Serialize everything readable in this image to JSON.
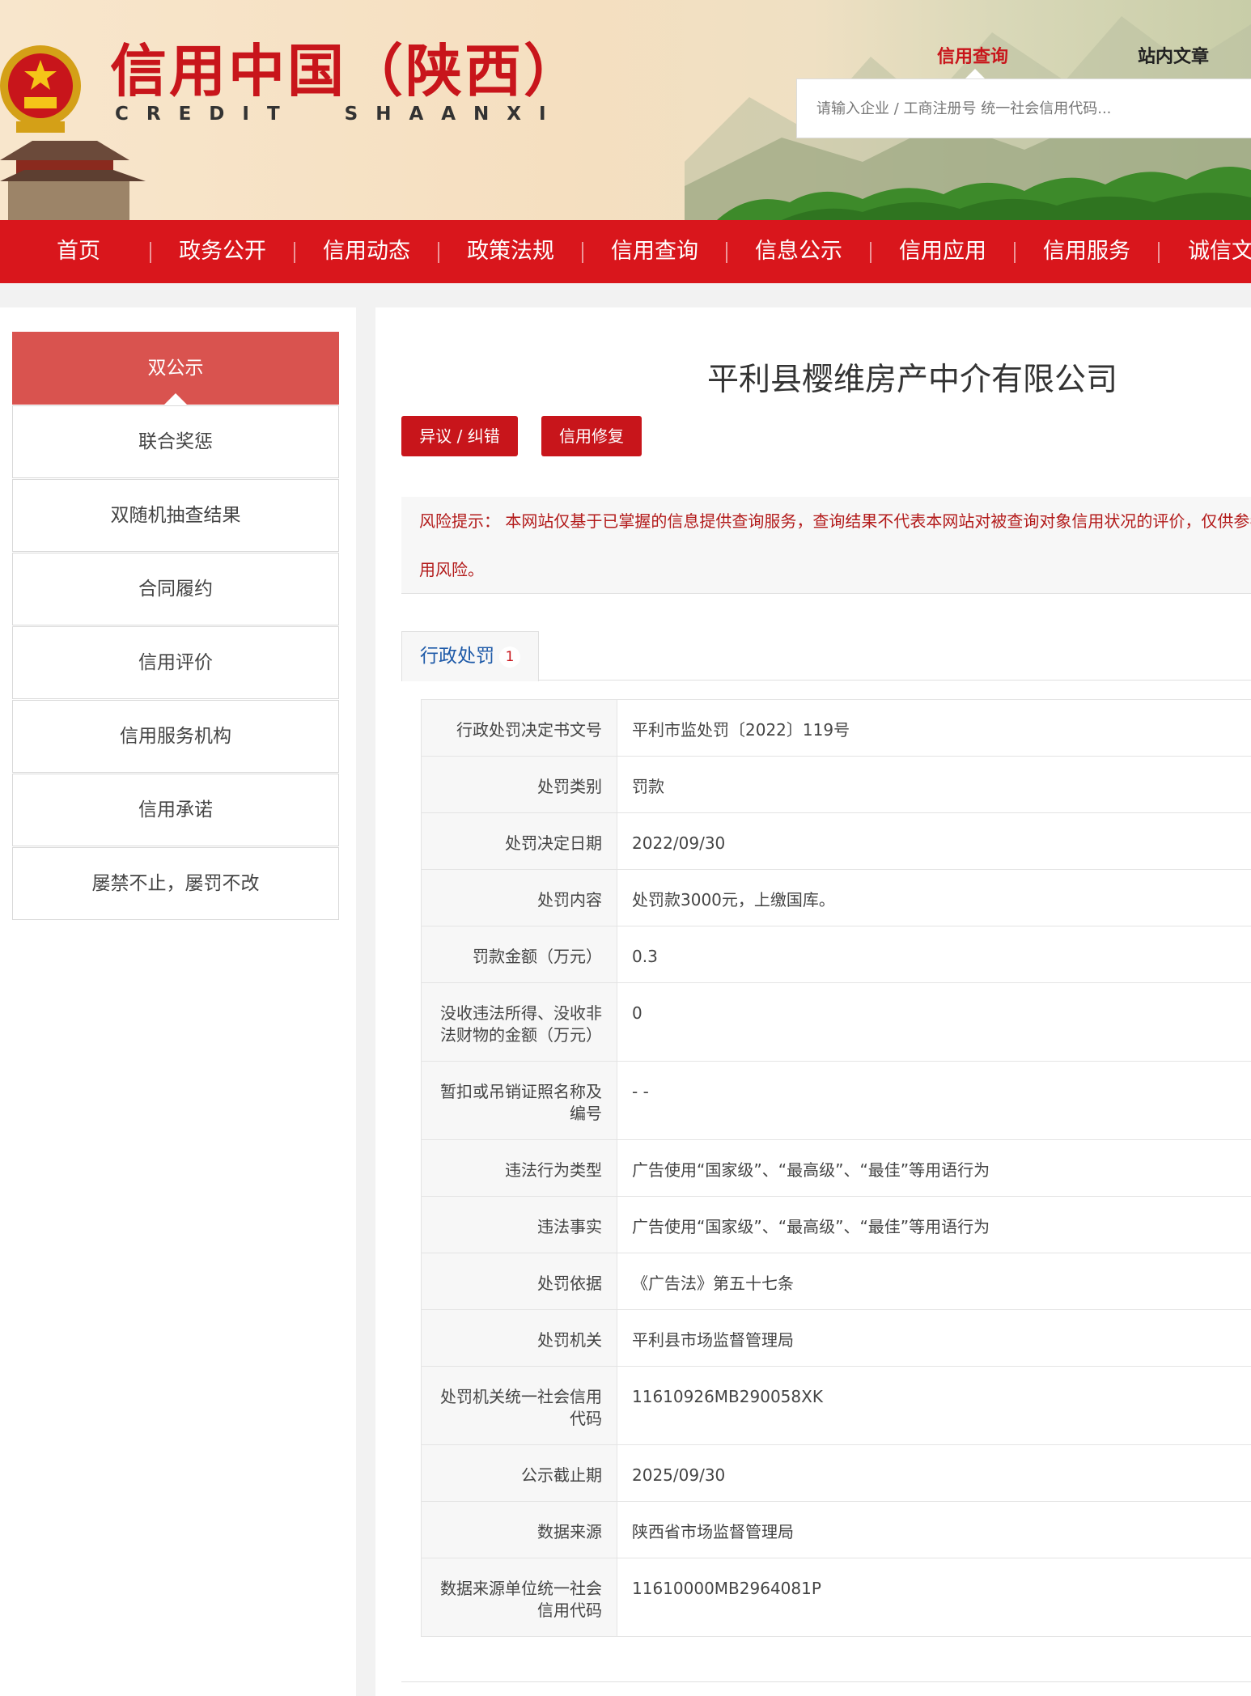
{
  "header": {
    "logo_cn": "信用中国（陕西）",
    "logo_en_1": "CREDIT",
    "logo_en_2": "SHAANXI",
    "tab_credit_query": "信用查询",
    "tab_site_article": "站内文章",
    "search_placeholder": "请输入企业 / 工商注册号 统一社会信用代码..."
  },
  "nav": {
    "items": [
      "首页",
      "政务公开",
      "信用动态",
      "政策法规",
      "信用查询",
      "信息公示",
      "信用应用",
      "信用服务",
      "诚信文"
    ]
  },
  "sidebar": {
    "items": [
      "双公示",
      "联合奖惩",
      "双随机抽查结果",
      "合同履约",
      "信用评价",
      "信用服务机构",
      "信用承诺",
      "屡禁不止，屡罚不改"
    ]
  },
  "main": {
    "company_name": "平利县樱维房产中介有限公司",
    "btn_dispute": "异议 / 纠错",
    "btn_repair": "信用修复",
    "risk_line1": "风险提示： 本网站仅基于已掌握的信息提供查询服务，查询结果不代表本网站对被查询对象信用状况的评价，仅供参考",
    "risk_line2": "用风险。",
    "tab_label": "行政处罚",
    "tab_count": "1",
    "rows": [
      {
        "k": "行政处罚决定书文号",
        "v": "平利市监处罚〔2022〕119号"
      },
      {
        "k": "处罚类别",
        "v": "罚款"
      },
      {
        "k": "处罚决定日期",
        "v": "2022/09/30"
      },
      {
        "k": "处罚内容",
        "v": "处罚款3000元，上缴国库。"
      },
      {
        "k": "罚款金额（万元）",
        "v": "0.3"
      },
      {
        "k": "没收违法所得、没收非法财物的金额（万元）",
        "v": "0"
      },
      {
        "k": "暂扣或吊销证照名称及编号",
        "v": "- -"
      },
      {
        "k": "违法行为类型",
        "v": "广告使用“国家级”、“最高级”、“最佳”等用语行为"
      },
      {
        "k": "违法事实",
        "v": "广告使用“国家级”、“最高级”、“最佳”等用语行为"
      },
      {
        "k": "处罚依据",
        "v": "《广告法》第五十七条"
      },
      {
        "k": "处罚机关",
        "v": "平利县市场监督管理局"
      },
      {
        "k": "处罚机关统一社会信用代码",
        "v": "11610926MB290058XK"
      },
      {
        "k": "公示截止期",
        "v": "2025/09/30"
      },
      {
        "k": "数据来源",
        "v": "陕西省市场监督管理局"
      },
      {
        "k": "数据来源单位统一社会信用代码",
        "v": "11610000MB2964081P"
      }
    ]
  }
}
